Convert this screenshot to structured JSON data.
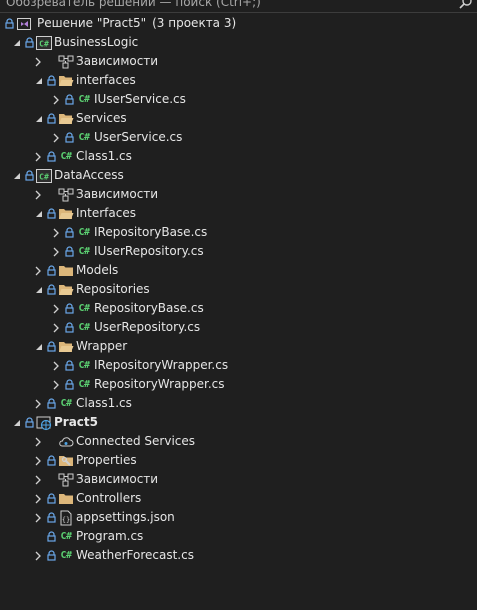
{
  "search": {
    "label": "Обозреватель решений — поиск (Ctrl+;)"
  },
  "solution": {
    "label": "Решение \"Pract5\"",
    "suffix": "(3 проекта 3)"
  },
  "tree": [
    {
      "label": "BusinessLogic",
      "icon": "csharp-project-icon",
      "state": "expanded"
    },
    {
      "label": "Зависимости",
      "icon": "dependencies-icon",
      "state": "collapsed"
    },
    {
      "label": "interfaces",
      "icon": "folder-open-icon",
      "state": "expanded"
    },
    {
      "label": "IUserService.cs",
      "icon": "csharp-file-icon",
      "state": "collapsed"
    },
    {
      "label": "Services",
      "icon": "folder-open-icon",
      "state": "expanded"
    },
    {
      "label": "UserService.cs",
      "icon": "csharp-file-icon",
      "state": "collapsed"
    },
    {
      "label": "Class1.cs",
      "icon": "csharp-file-icon",
      "state": "collapsed"
    },
    {
      "label": "DataAccess",
      "icon": "csharp-project-icon",
      "state": "expanded"
    },
    {
      "label": "Зависимости",
      "icon": "dependencies-icon",
      "state": "collapsed"
    },
    {
      "label": "Interfaces",
      "icon": "folder-open-icon",
      "state": "expanded"
    },
    {
      "label": "IRepositoryBase.cs",
      "icon": "csharp-file-icon",
      "state": "collapsed"
    },
    {
      "label": "IUserRepository.cs",
      "icon": "csharp-file-icon",
      "state": "collapsed"
    },
    {
      "label": "Models",
      "icon": "folder-icon",
      "state": "collapsed"
    },
    {
      "label": "Repositories",
      "icon": "folder-open-icon",
      "state": "expanded"
    },
    {
      "label": "RepositoryBase.cs",
      "icon": "csharp-file-icon",
      "state": "collapsed"
    },
    {
      "label": "UserRepository.cs",
      "icon": "csharp-file-icon",
      "state": "collapsed"
    },
    {
      "label": "Wrapper",
      "icon": "folder-open-icon",
      "state": "expanded"
    },
    {
      "label": "IRepositoryWrapper.cs",
      "icon": "csharp-file-icon",
      "state": "collapsed"
    },
    {
      "label": "RepositoryWrapper.cs",
      "icon": "csharp-file-icon",
      "state": "collapsed"
    },
    {
      "label": "Class1.cs",
      "icon": "csharp-file-icon",
      "state": "collapsed"
    },
    {
      "label": "Pract5",
      "icon": "web-project-icon",
      "state": "expanded"
    },
    {
      "label": "Connected Services",
      "icon": "connected-services-icon",
      "state": "collapsed"
    },
    {
      "label": "Properties",
      "icon": "properties-folder-icon",
      "state": "collapsed"
    },
    {
      "label": "Зависимости",
      "icon": "dependencies-icon",
      "state": "collapsed"
    },
    {
      "label": "Controllers",
      "icon": "folder-icon",
      "state": "collapsed"
    },
    {
      "label": "appsettings.json",
      "icon": "json-file-icon",
      "state": "collapsed"
    },
    {
      "label": "Program.cs",
      "icon": "csharp-file-icon",
      "state": "none"
    },
    {
      "label": "WeatherForecast.cs",
      "icon": "csharp-file-icon",
      "state": "collapsed"
    }
  ],
  "colors": {
    "background": "#1f1f1f",
    "text": "#e6e6e6",
    "csharp": "#5bcf71",
    "folder": "#dcb67a",
    "lock": "#6aa7e8"
  }
}
